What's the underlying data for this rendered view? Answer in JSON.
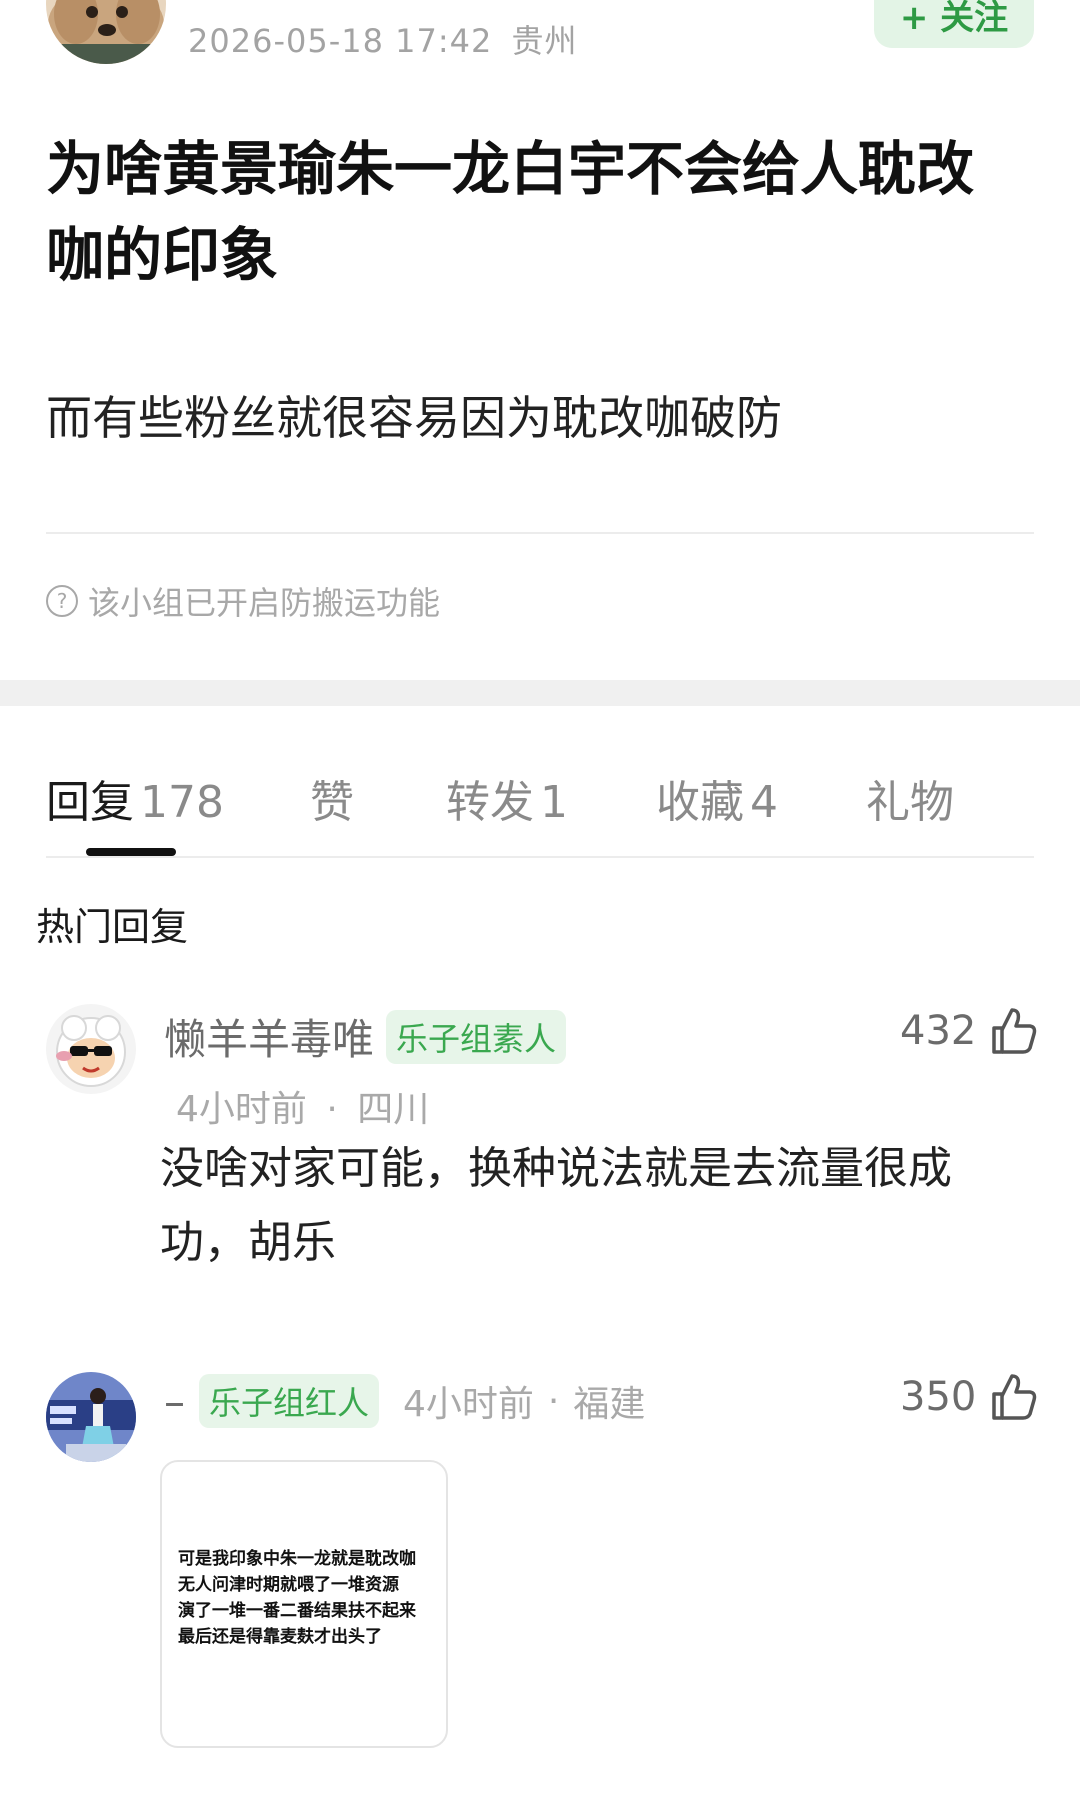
{
  "post": {
    "date": "2026-05-18 17:42",
    "location": "贵州",
    "follow_label": "+ 关注",
    "title": "为啥黄景瑜朱一龙白宇不会给人耽改咖的印象",
    "body": "而有些粉丝就很容易因为耽改咖破防",
    "notice": "该小组已开启防搬运功能"
  },
  "tabs": [
    {
      "label": "回复",
      "count": "178"
    },
    {
      "label": "赞",
      "count": ""
    },
    {
      "label": "转发",
      "count": "1"
    },
    {
      "label": "收藏",
      "count": "4"
    },
    {
      "label": "礼物",
      "count": ""
    }
  ],
  "section_title": "热门回复",
  "comments": [
    {
      "name": "懒羊羊毒唯",
      "badge": "乐子组素人",
      "time": "4小时前",
      "location": "四川",
      "likes": "432",
      "text": "没啥对家可能，换种说法就是去流量很成功，胡乐"
    },
    {
      "name": "–",
      "badge": "乐子组红人",
      "time": "4小时前",
      "location": "福建",
      "likes": "350",
      "image_text": [
        "可是我印象中朱一龙就是耽改咖",
        "无人问津时期就喂了一堆资源",
        "演了一堆一番二番结果扶不起来",
        "最后还是得靠麦麸才出头了"
      ]
    }
  ],
  "colors": {
    "accent": "#2e9a44",
    "badge_bg": "#e7f5e9",
    "badge_text": "#3aa84f"
  },
  "icons": [
    "question-circle-icon",
    "thumbs-up-icon"
  ]
}
